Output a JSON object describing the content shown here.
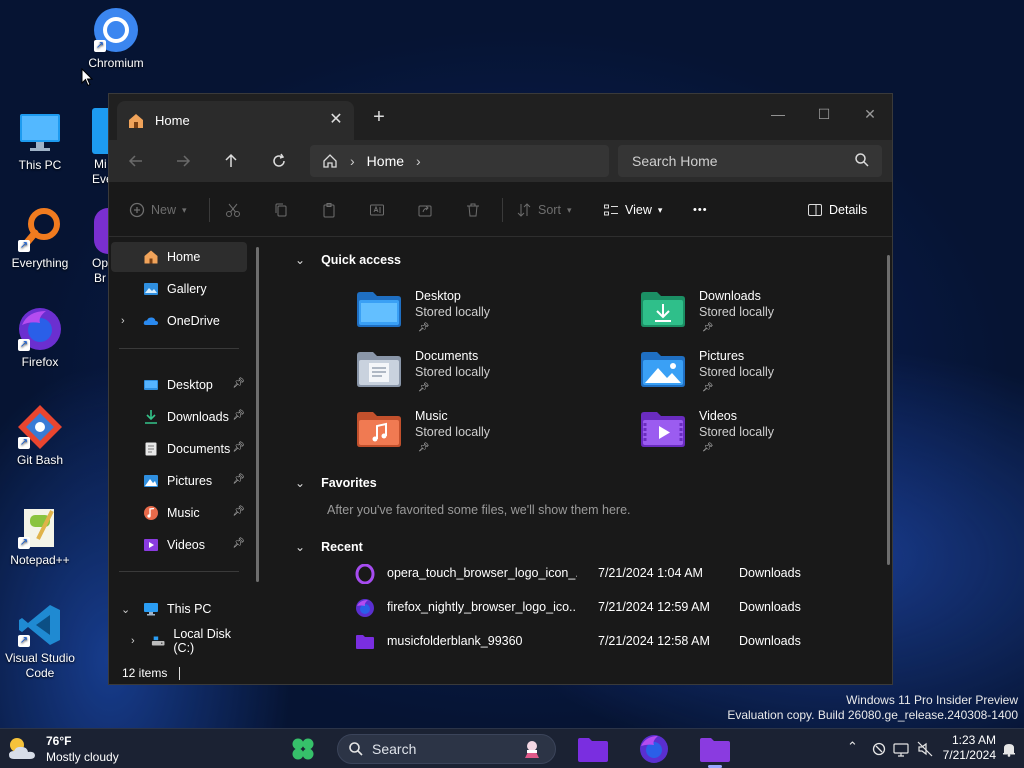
{
  "desktop": {
    "icons": [
      {
        "label": "Chromium"
      },
      {
        "label": "This PC"
      },
      {
        "label": "Everything"
      },
      {
        "label": "Firefox"
      },
      {
        "label": "Git Bash"
      },
      {
        "label": "Notepad++"
      },
      {
        "label": "Visual Studio Code"
      }
    ],
    "partial_labels": [
      "Mi",
      "Eve",
      "Op",
      "Br"
    ],
    "watermark_line1": "Windows 11 Pro Insider Preview",
    "watermark_line2": "Evaluation copy. Build 26080.ge_release.240308-1400"
  },
  "window": {
    "tab_title": "Home",
    "tab_close": "✕",
    "new_tab": "+",
    "minimize": "—",
    "maximize": "☐",
    "close": "✕",
    "breadcrumb": "Home",
    "search_placeholder": "Search Home",
    "toolbar": {
      "new": "New",
      "sort": "Sort",
      "view": "View",
      "more": "•••",
      "details": "Details"
    },
    "sidebar": {
      "top": [
        {
          "label": "Home"
        },
        {
          "label": "Gallery"
        },
        {
          "label": "OneDrive"
        }
      ],
      "pinned": [
        {
          "label": "Desktop"
        },
        {
          "label": "Downloads"
        },
        {
          "label": "Documents"
        },
        {
          "label": "Pictures"
        },
        {
          "label": "Music"
        },
        {
          "label": "Videos"
        }
      ],
      "this_pc": "This PC",
      "local_disk": "Local Disk (C:)"
    },
    "sections": {
      "quick_access": "Quick access",
      "favorites": "Favorites",
      "favorites_empty": "After you've favorited some files, we'll show them here.",
      "recent": "Recent"
    },
    "quick_access": [
      {
        "name": "Desktop",
        "sub": "Stored locally"
      },
      {
        "name": "Downloads",
        "sub": "Stored locally"
      },
      {
        "name": "Documents",
        "sub": "Stored locally"
      },
      {
        "name": "Pictures",
        "sub": "Stored locally"
      },
      {
        "name": "Music",
        "sub": "Stored locally"
      },
      {
        "name": "Videos",
        "sub": "Stored locally"
      }
    ],
    "recent": [
      {
        "name": "opera_touch_browser_logo_icon_...",
        "date": "7/21/2024 1:04 AM",
        "location": "Downloads"
      },
      {
        "name": "firefox_nightly_browser_logo_ico...",
        "date": "7/21/2024 12:59 AM",
        "location": "Downloads"
      },
      {
        "name": "musicfolderblank_99360",
        "date": "7/21/2024 12:58 AM",
        "location": "Downloads"
      }
    ],
    "status": "12 items"
  },
  "taskbar": {
    "weather_temp": "76°F",
    "weather_desc": "Mostly cloudy",
    "search_placeholder": "Search",
    "time": "1:23 AM",
    "date": "7/21/2024"
  },
  "colors": {
    "accent": "#4cc2ff",
    "folder_blue": "#2f8fe0",
    "folder_green": "#27a67a",
    "folder_orange": "#e56a3a",
    "folder_purple": "#8a3be0"
  }
}
